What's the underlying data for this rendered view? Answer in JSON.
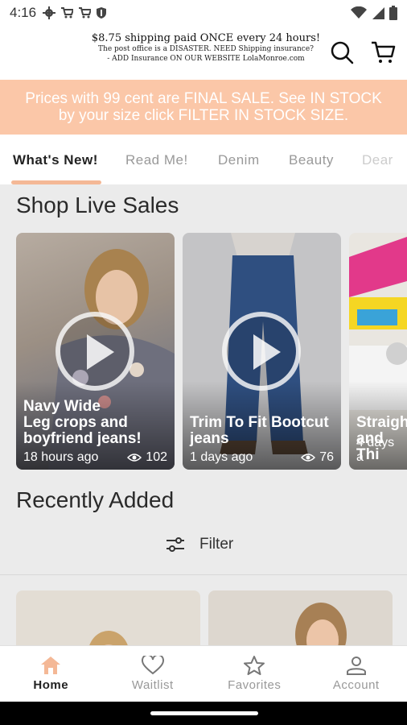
{
  "status_bar": {
    "time": "4:16"
  },
  "header": {
    "promo_line1": "$8.75 shipping paid ONCE every 24 hours!",
    "promo_line2": "The post office is a DISASTER. NEED Shipping insurance?",
    "promo_line3": "- ADD Insurance ON OUR WEBSITE LolaMonroe.com"
  },
  "banner": {
    "line1": "Prices with 99 cent are FINAL SALE. See IN STOCK",
    "line2": "by your size click FILTER IN STOCK SIZE."
  },
  "tabs": [
    {
      "label": "What's New!"
    },
    {
      "label": "Read Me!"
    },
    {
      "label": "Denim"
    },
    {
      "label": "Beauty"
    },
    {
      "label": "Dear"
    }
  ],
  "live_sales": {
    "title": "Shop Live Sales",
    "cards": [
      {
        "title_line1": "Navy Wide",
        "title_line2": "Leg crops and",
        "title_line3": "boyfriend jeans!",
        "time": "18 hours ago",
        "views": "102"
      },
      {
        "title_line1": "Trim To Fit Bootcut",
        "title_line2": "jeans",
        "time": "1 days ago",
        "views": "76"
      },
      {
        "title_line1": "Straigh",
        "title_line2": "and Thi",
        "time": "4 days a"
      }
    ]
  },
  "recently_added": {
    "title": "Recently Added",
    "filter_label": "Filter"
  },
  "bottom_nav": [
    {
      "label": "Home"
    },
    {
      "label": "Waitlist"
    },
    {
      "label": "Favorites"
    },
    {
      "label": "Account"
    }
  ],
  "colors": {
    "accent": "#f4b896",
    "banner_bg": "#fbc7a8",
    "content_bg": "#ebebeb"
  }
}
